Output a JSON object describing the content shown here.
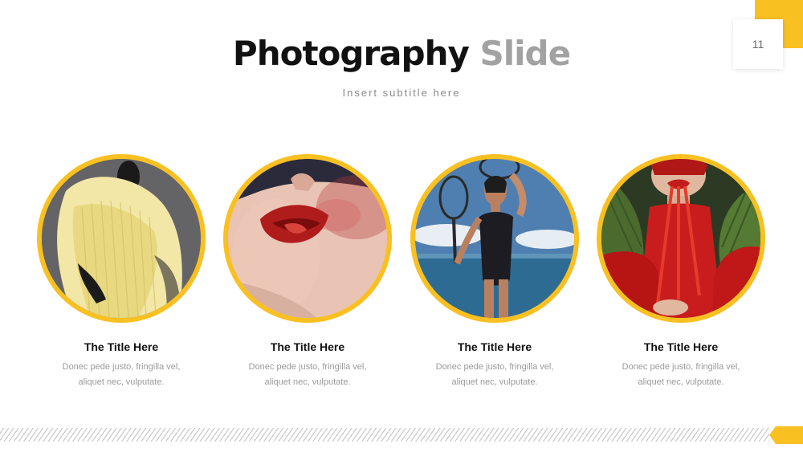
{
  "slide": {
    "page_number": "11",
    "title_main": "Photography",
    "title_accent": "Slide",
    "subtitle": "Insert subtitle here"
  },
  "colors": {
    "accent": "#f9c022",
    "title_dark": "#111111",
    "title_gray": "#a2a2a2",
    "body_text": "#9a9a9a"
  },
  "cards": [
    {
      "title": "The Title Here",
      "text_line1": "Donec pede justo, fringilla vel,",
      "text_line2": "aliquet nec, vulputate."
    },
    {
      "title": "The Title Here",
      "text_line1": "Donec pede justo, fringilla vel,",
      "text_line2": "aliquet nec, vulputate."
    },
    {
      "title": "The Title Here",
      "text_line1": "Donec pede justo, fringilla vel,",
      "text_line2": "aliquet nec, vulputate."
    },
    {
      "title": "The Title Here",
      "text_line1": "Donec pede justo, fringilla vel,",
      "text_line2": "aliquet nec, vulputate."
    }
  ]
}
